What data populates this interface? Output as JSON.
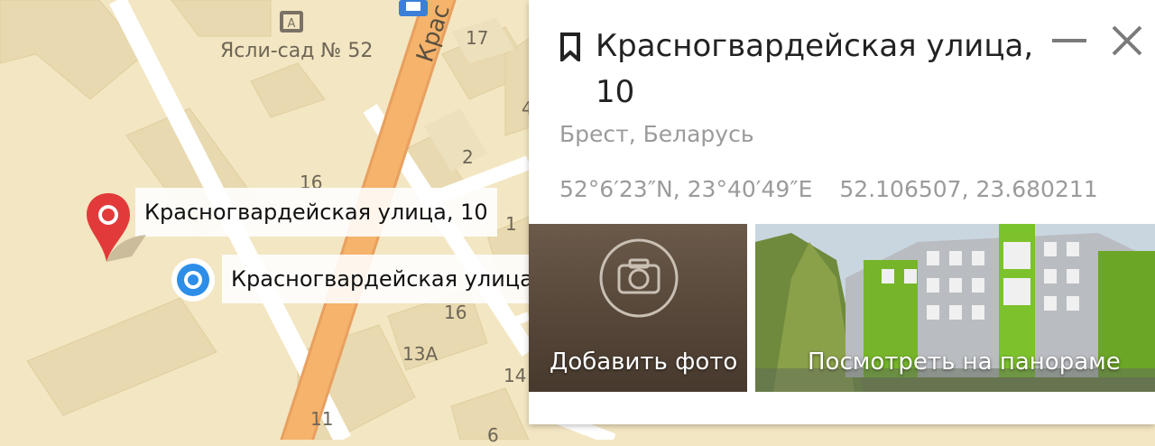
{
  "map": {
    "poi_label": "Ясли-сад № 52",
    "house_numbers": [
      "17",
      "2",
      "16",
      "1",
      "16",
      "13А",
      "14",
      "11",
      "6",
      "4"
    ],
    "street_fragment": "Крас",
    "pin_red_label": "Красногвардейская улица, 10",
    "pin_blue_label": "Красногвардейская улица",
    "icons": [
      "kindergarten-icon",
      "transport-icon",
      "red-pin-icon",
      "blue-location-icon"
    ]
  },
  "panel": {
    "title": "Красногвардейская улица, 10",
    "subtitle": "Брест, Беларусь",
    "coords_dms": "52°6′23″N, 23°40′49″E",
    "coords_decimal": "52.106507, 23.680211",
    "add_photo_label": "Добавить фото",
    "panorama_label": "Посмотреть на панораме"
  },
  "colors": {
    "map_bg": "#f3e6c2",
    "main_road": "#f6b36b",
    "pin_red": "#e23a3a",
    "pin_blue": "#2d8ee8"
  }
}
